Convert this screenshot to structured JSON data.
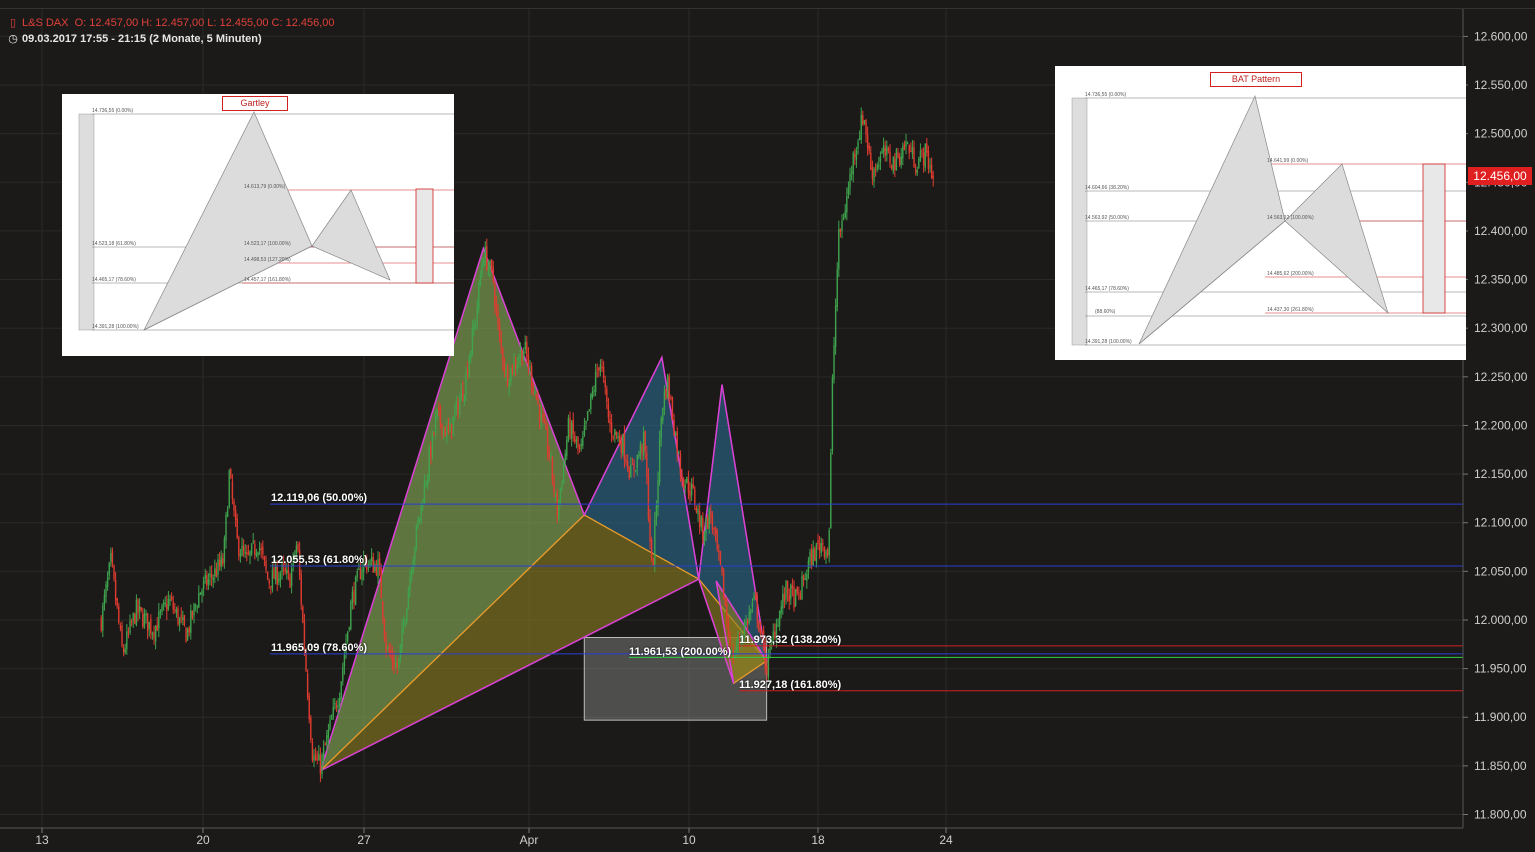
{
  "header": {
    "symbol": "L&S DAX",
    "ohlc": "O: 12.457,00   H: 12.457,00   L: 12.455,00   C: 12.456,00",
    "timerange": "09.03.2017 17:55 - 21:15   (2 Monate, 5 Minuten)"
  },
  "colors": {
    "background": "#1b1a19",
    "candle_up": "#3fa34d",
    "candle_down": "#e03b2f",
    "pattern_green": "#8db25a",
    "pattern_olive": "#8e7f1f",
    "pattern_blue": "#2a6a8c",
    "outline_orange": "#e89b2a",
    "outline_magenta": "#d83fd8",
    "level_blue": "#2a3fd0",
    "level_red": "#d02020",
    "level_green": "#30d040",
    "price_marker": "#e02020"
  },
  "price_marker": "12.456,00",
  "chart_data": {
    "type": "candlestick",
    "x_ticks": [
      "13",
      "20",
      "27",
      "Apr",
      "10",
      "18",
      "24"
    ],
    "y_ticks": [
      "11.800,00",
      "11.850,00",
      "11.900,00",
      "11.950,00",
      "12.000,00",
      "12.050,00",
      "12.100,00",
      "12.150,00",
      "12.200,00",
      "12.250,00",
      "12.300,00",
      "12.350,00",
      "12.400,00",
      "12.450,00",
      "12.500,00",
      "12.550,00",
      "12.600,00"
    ],
    "ylim": [
      11800,
      12600
    ],
    "price_path": [
      {
        "d": -8.7,
        "p": 12000
      },
      {
        "d": -8.2,
        "p": 12060
      },
      {
        "d": -7.6,
        "p": 11965
      },
      {
        "d": -6.9,
        "p": 12010
      },
      {
        "d": -6.0,
        "p": 11990
      },
      {
        "d": -5.2,
        "p": 12020
      },
      {
        "d": -4.3,
        "p": 11985
      },
      {
        "d": -3.6,
        "p": 12030
      },
      {
        "d": -2.4,
        "p": 12060
      },
      {
        "d": -2.1,
        "p": 12150
      },
      {
        "d": -1.7,
        "p": 12080
      },
      {
        "d": -1.2,
        "p": 12060
      },
      {
        "d": -0.6,
        "p": 12080
      },
      {
        "d": -0.1,
        "p": 12040
      },
      {
        "d": 0.6,
        "p": 12050
      },
      {
        "d": 1.0,
        "p": 12040
      },
      {
        "d": 1.4,
        "p": 12080
      },
      {
        "d": 1.8,
        "p": 11965
      },
      {
        "d": 2.2,
        "p": 11860
      },
      {
        "d": 2.6,
        "p": 11850
      },
      {
        "d": 3.6,
        "p": 11930
      },
      {
        "d": 4.2,
        "p": 12020
      },
      {
        "d": 4.8,
        "p": 12060
      },
      {
        "d": 5.6,
        "p": 12055
      },
      {
        "d": 6.0,
        "p": 11970
      },
      {
        "d": 6.6,
        "p": 11950
      },
      {
        "d": 7.3,
        "p": 12060
      },
      {
        "d": 7.9,
        "p": 12130
      },
      {
        "d": 8.6,
        "p": 12210
      },
      {
        "d": 9.2,
        "p": 12190
      },
      {
        "d": 10.0,
        "p": 12240
      },
      {
        "d": 10.6,
        "p": 12310
      },
      {
        "d": 11.0,
        "p": 12380
      },
      {
        "d": 11.5,
        "p": 12350
      },
      {
        "d": 11.8,
        "p": 12290
      },
      {
        "d": 12.2,
        "p": 12250
      },
      {
        "d": 13.1,
        "p": 12280
      },
      {
        "d": 13.6,
        "p": 12240
      },
      {
        "d": 14.4,
        "p": 12170
      },
      {
        "d": 14.8,
        "p": 12110
      },
      {
        "d": 15.4,
        "p": 12200
      },
      {
        "d": 16.0,
        "p": 12170
      },
      {
        "d": 16.6,
        "p": 12230
      },
      {
        "d": 17.0,
        "p": 12270
      },
      {
        "d": 17.5,
        "p": 12200
      },
      {
        "d": 18.2,
        "p": 12180
      },
      {
        "d": 18.6,
        "p": 12150
      },
      {
        "d": 19.3,
        "p": 12185
      },
      {
        "d": 19.7,
        "p": 12045
      },
      {
        "d": 20.2,
        "p": 12220
      },
      {
        "d": 20.5,
        "p": 12245
      },
      {
        "d": 21.2,
        "p": 12150
      },
      {
        "d": 21.8,
        "p": 12130
      },
      {
        "d": 22.3,
        "p": 12090
      },
      {
        "d": 22.7,
        "p": 12110
      },
      {
        "d": 23.3,
        "p": 12040
      },
      {
        "d": 23.8,
        "p": 11960
      },
      {
        "d": 24.4,
        "p": 11990
      },
      {
        "d": 25.0,
        "p": 12020
      },
      {
        "d": 25.6,
        "p": 11950
      },
      {
        "d": 26.0,
        "p": 11990
      },
      {
        "d": 26.6,
        "p": 12030
      },
      {
        "d": 27.2,
        "p": 12020
      },
      {
        "d": 27.8,
        "p": 12060
      },
      {
        "d": 28.4,
        "p": 12080
      },
      {
        "d": 28.8,
        "p": 12070
      },
      {
        "d": 29.0,
        "p": 12250
      },
      {
        "d": 29.3,
        "p": 12390
      },
      {
        "d": 29.7,
        "p": 12430
      },
      {
        "d": 30.1,
        "p": 12480
      },
      {
        "d": 30.6,
        "p": 12520
      },
      {
        "d": 31.0,
        "p": 12460
      },
      {
        "d": 31.6,
        "p": 12480
      },
      {
        "d": 32.2,
        "p": 12470
      },
      {
        "d": 32.8,
        "p": 12490
      },
      {
        "d": 33.3,
        "p": 12470
      },
      {
        "d": 33.8,
        "p": 12480
      },
      {
        "d": 34.2,
        "p": 12455
      }
    ],
    "levels": [
      {
        "value": 12119.06,
        "label": "12.119,06 (50.00%)",
        "color": "#2a3fd0"
      },
      {
        "value": 12055.53,
        "label": "12.055,53 (61.80%)",
        "color": "#2a3fd0"
      },
      {
        "value": 11965.09,
        "label": "11.965,09 (78.60%)",
        "color": "#2a3fd0"
      },
      {
        "value": 11961.53,
        "label": "11.961,53 (200.00%)",
        "color": "#30d040"
      },
      {
        "value": 11973.32,
        "label": "11.973,32 (138.20%)",
        "color": "#d02020"
      },
      {
        "value": 11927.18,
        "label": "11.927,18 (161.80%)",
        "color": "#d02020"
      }
    ],
    "zone": {
      "d_from": 16.2,
      "d_to": 25.6,
      "p_from": 11897,
      "p_to": 11982
    },
    "gartley": {
      "X": {
        "d": 2.6,
        "p": 11845
      },
      "A": {
        "d": 11.0,
        "p": 12382
      },
      "B": {
        "d": 16.2,
        "p": 12108
      },
      "C": {
        "d": 20.2,
        "p": 12270
      },
      "D": {
        "d": 22.1,
        "p": 12042
      }
    },
    "bat": {
      "X": {
        "d": 22.1,
        "p": 12042
      },
      "A": {
        "d": 23.3,
        "p": 12242
      },
      "B": {
        "d": 25.6,
        "p": 11958
      },
      "C": {
        "d": 23.0,
        "p": 12040
      },
      "D": {
        "d": 23.9,
        "p": 11935
      }
    }
  },
  "insets": [
    {
      "title": "Gartley",
      "labels": [
        "14.736,55 (0.00%)",
        "14.613,79 (0.00%)",
        "14.523,18 (61.80%)",
        "14.523,17 (100.00%)",
        "14.498,53 (127.20%)",
        "14.465,17 (78.60%)",
        "14.457,17 (161.80%)",
        "14.391,28 (100.00%)"
      ]
    },
    {
      "title": "BAT Pattern",
      "labels": [
        "14.736,55 (0.00%)",
        "14.641,99 (0.00%)",
        "14.604,66 (38.20%)",
        "14.563,92 (50.00%)",
        "14.563,92 (100.00%)",
        "14.485,62 (200.00%)",
        "14.465,17 (78.60%)",
        "(88.60%)",
        "14.437,30 (261.80%)",
        "14.391,28 (100.00%)"
      ]
    }
  ]
}
